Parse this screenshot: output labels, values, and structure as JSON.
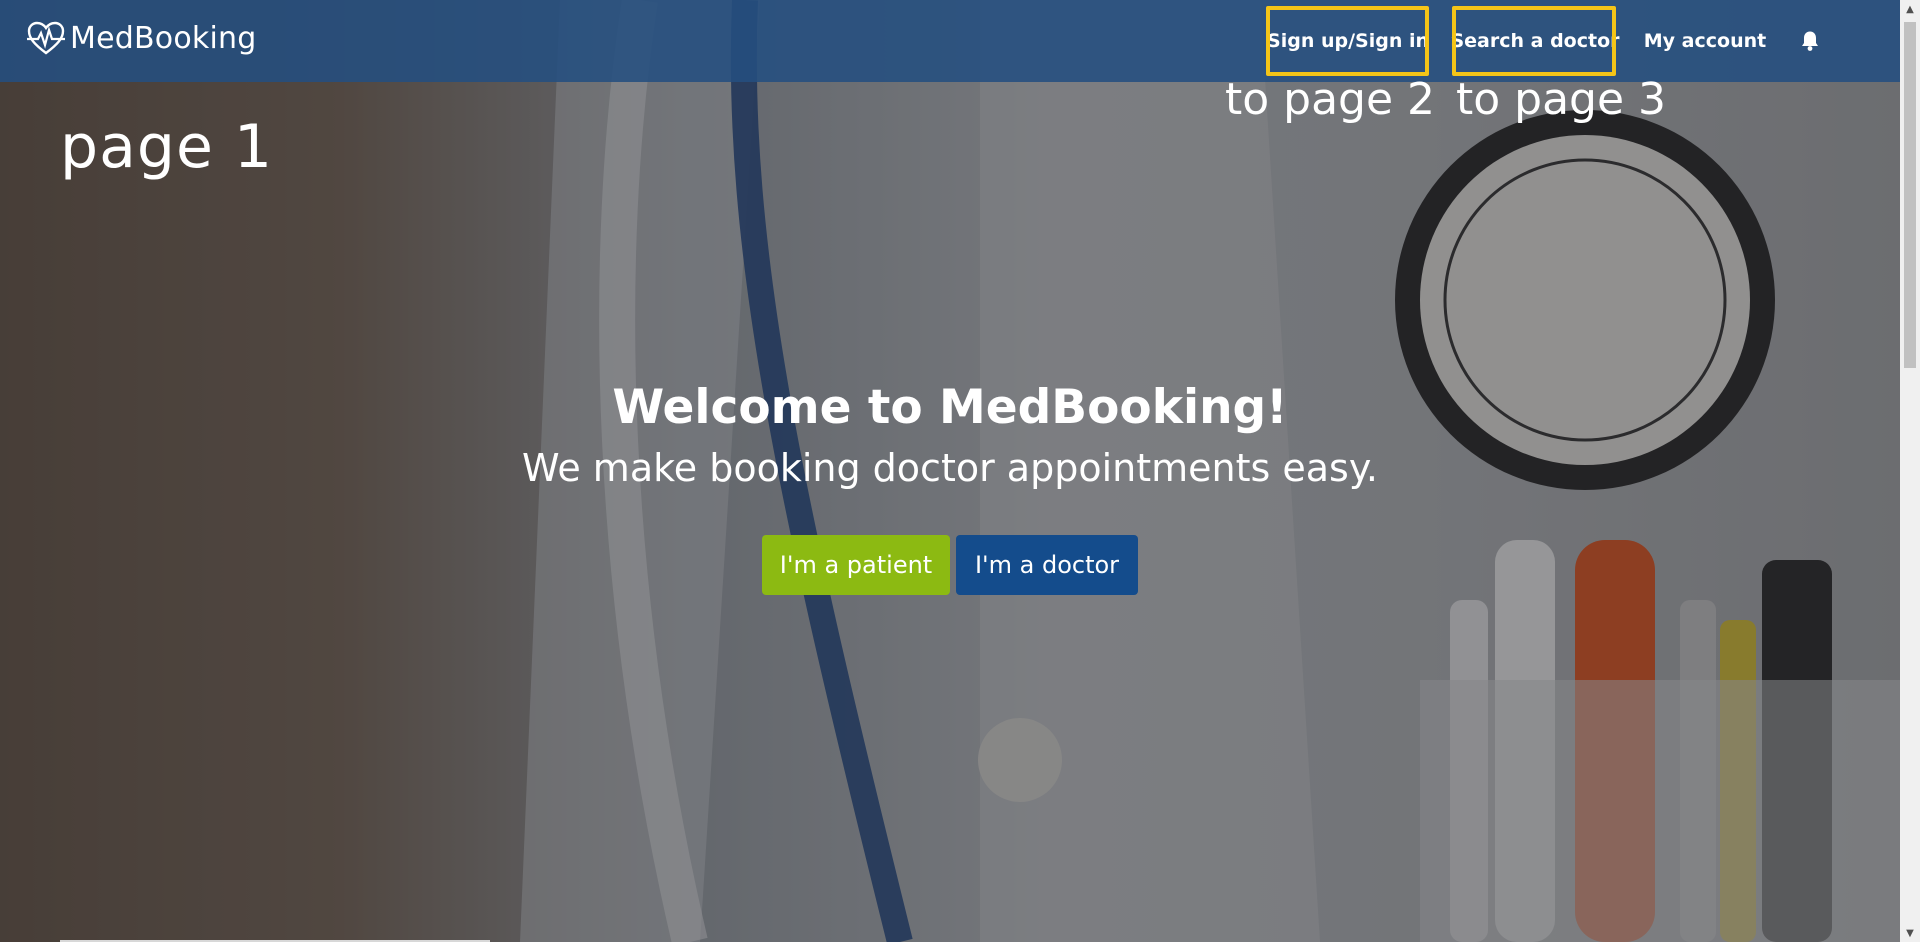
{
  "brand": {
    "name": "MedBooking",
    "icon": "heartbeat-heart-icon"
  },
  "nav": {
    "signin": "Sign up/Sign in",
    "search": "Search a doctor",
    "account": "My account",
    "bell_icon": "bell-icon"
  },
  "annotations": {
    "page": "page 1",
    "to_page_2": "to page 2",
    "to_page_3": "to page 3",
    "highlight_color": "#f5c518"
  },
  "hero": {
    "title": "Welcome to MedBooking!",
    "subtitle": "We make booking doctor appointments easy.",
    "patient_button": "I'm a patient",
    "doctor_button": "I'm a doctor"
  },
  "colors": {
    "navbar": "#244e80",
    "patient_button": "#8cba12",
    "doctor_button": "#144c8c"
  }
}
